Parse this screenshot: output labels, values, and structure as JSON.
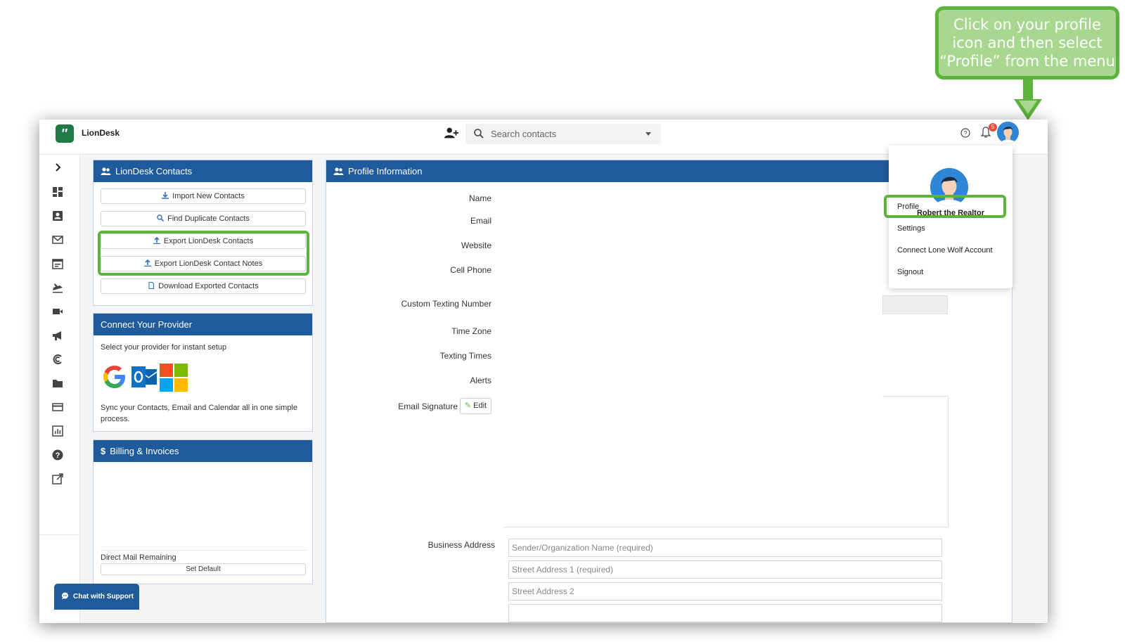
{
  "callout": {
    "text": "Click on your profile icon and then select “Profile” from the menu"
  },
  "app": {
    "brand": "LionDesk"
  },
  "header": {
    "search_placeholder": "Search contacts",
    "notification_count": "5"
  },
  "contacts_panel": {
    "title": "LionDesk Contacts",
    "buttons": [
      "Import New Contacts",
      "Find Duplicate Contacts",
      "Export LionDesk Contacts",
      "Export LionDesk Contact Notes",
      "Download Exported Contacts"
    ]
  },
  "provider_panel": {
    "title": "Connect Your Provider",
    "intro": "Select your provider for instant setup",
    "description": "Sync your Contacts, Email and Calendar all in one simple process."
  },
  "billing_panel": {
    "title": "Billing & Invoices",
    "direct_mail_label": "Direct Mail Remaining",
    "set_default_label": "Set Default"
  },
  "profile_panel": {
    "title": "Profile Information",
    "labels": {
      "name": "Name",
      "email": "Email",
      "website": "Website",
      "cell_phone": "Cell Phone",
      "custom_texting_number": "Custom Texting Number",
      "time_zone": "Time Zone",
      "texting_times": "Texting Times",
      "alerts": "Alerts",
      "email_signature": "Email Signature",
      "business_address": "Business Address"
    },
    "edit_label": "Edit",
    "address_placeholders": [
      "Sender/Organization Name (required)",
      "Street Address 1 (required)",
      "Street Address 2"
    ]
  },
  "user_menu": {
    "user_name": "Robert the Realtor",
    "items": [
      "Profile",
      "Settings",
      "Connect Lone Wolf Account",
      "Signout"
    ]
  },
  "chat": {
    "label": "Chat with Support"
  },
  "colors": {
    "accent_green": "#5cb43c",
    "panel_header_blue": "#1f5b9a",
    "avatar_blue": "#2f86d6"
  }
}
